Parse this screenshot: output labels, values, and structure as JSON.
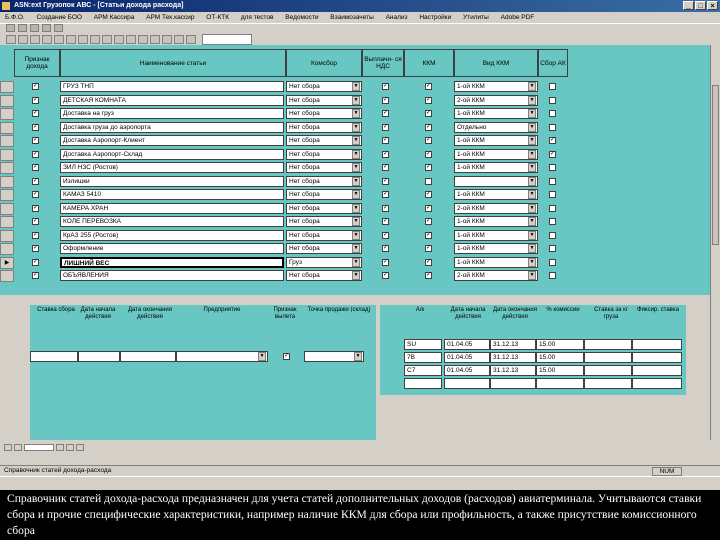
{
  "window": {
    "title": "ASN:ext Грузопок АВС - [Статьи дохода расхода]"
  },
  "menu": [
    "Б.Ф.О.",
    "Создание БОО",
    "АРМ Кассира",
    "АРМ Тех.кассир",
    "ОТ-КТК",
    "для тестов",
    "Ведомости",
    "Взаимозачеты",
    "Анализ",
    "Настройки",
    "Утилиты",
    "Adobe PDF"
  ],
  "header": {
    "col1": "Признак дохода",
    "col2": "Наименование статьи",
    "col3": "Комсбор",
    "col4": "Выплачи- ся НДС",
    "col5": "ККМ",
    "col6": "Вид ККМ",
    "col7": "Сбор АК"
  },
  "rows": [
    {
      "name": "ГРУЗ ТНП",
      "kom": "Нет сбора",
      "vid": "1-ой ККМ",
      "nds": "✓",
      "kkm": "✓",
      "ak": ""
    },
    {
      "name": "ДЕТСКАЯ КОМНАТА",
      "kom": "Нет сбора",
      "vid": "2-ой ККМ",
      "nds": "✓",
      "kkm": "✓",
      "ak": ""
    },
    {
      "name": "Доставка на груз",
      "kom": "Нет сбора",
      "vid": "1-ой ККМ",
      "nds": "✓",
      "kkm": "✓",
      "ak": ""
    },
    {
      "name": "Доставка груза до аэропорта",
      "kom": "Нет сбора",
      "vid": "Отдельно",
      "nds": "✓",
      "kkm": "✓",
      "ak": ""
    },
    {
      "name": "Доставка Аэропорт-Клиент",
      "kom": "Нет сбора",
      "vid": "1-ой ККМ",
      "nds": "✓",
      "kkm": "✓",
      "ak": "✓"
    },
    {
      "name": "Доставка Аэропорт-Склад",
      "kom": "Нет сбора",
      "vid": "1-ой ККМ",
      "nds": "✓",
      "kkm": "✓",
      "ak": "✓"
    },
    {
      "name": "ЗИЛ НЗС (Ростов)",
      "kom": "Нет сбора",
      "vid": "1-ой ККМ",
      "nds": "✓",
      "kkm": "✓",
      "ak": ""
    },
    {
      "name": "Излишки",
      "kom": "Нет сбора",
      "vid": "",
      "nds": "✓",
      "kkm": "",
      "ak": ""
    },
    {
      "name": "КАМАЗ 5410",
      "kom": "Нет сбора",
      "vid": "1-ой ККМ",
      "nds": "✓",
      "kkm": "✓",
      "ak": ""
    },
    {
      "name": "КАМЕРА ХРАН",
      "kom": "Нет сбора",
      "vid": "2-ой ККМ",
      "nds": "✓",
      "kkm": "✓",
      "ak": ""
    },
    {
      "name": "КОЛЕ ПЕРЕВОЗКА",
      "kom": "Нет сбора",
      "vid": "1-ой ККМ",
      "nds": "✓",
      "kkm": "✓",
      "ak": ""
    },
    {
      "name": "КрАЗ 255 (Ростов)",
      "kom": "Нет сбора",
      "vid": "1-ой ККМ",
      "nds": "✓",
      "kkm": "✓",
      "ak": ""
    },
    {
      "name": "Оформление",
      "kom": "Нет сбора",
      "vid": "1-ой ККМ",
      "nds": "✓",
      "kkm": "✓",
      "ak": ""
    },
    {
      "name": "ЛИШНИЙ ВЕС",
      "kom": "Груз",
      "vid": "1-ой ККМ",
      "nds": "✓",
      "kkm": "✓",
      "ak": ""
    },
    {
      "name": "ОБЪЯВЛЕНИЯ",
      "kom": "Нет сбора",
      "vid": "2-ой ККМ",
      "nds": "✓",
      "kkm": "✓",
      "ak": ""
    }
  ],
  "sub_left": {
    "headers": [
      "Ставка сбора",
      "Дата начала действия",
      "Дата окончания действия",
      "Предприятие",
      "Признак вылета",
      "Точка продажи (склад)"
    ],
    "row": {
      "a": "",
      "b": "",
      "c": "",
      "d": "",
      "e": "✓",
      "f": ""
    }
  },
  "sub_right": {
    "headers": [
      "А/к",
      "Дата начала действия",
      "Дата окончания действия",
      "% комиссии",
      "Ставка за кг груза",
      "Фиксир. ставка"
    ],
    "rows": [
      {
        "ak": "SU",
        "d1": "01.04.05",
        "d2": "31.12.13",
        "pct": "15.00"
      },
      {
        "ak": "7B",
        "d1": "01.04.05",
        "d2": "31.12.13",
        "pct": "15.00"
      },
      {
        "ak": "C7",
        "d1": "01.04.05",
        "d2": "31.12.13",
        "pct": "15.00"
      }
    ]
  },
  "status": {
    "num": "NUM",
    "left": "Справочник статей дохода-расхода"
  },
  "caption": "Справочник статей дохода-расхода предназначен для учета статей дополнительных доходов (расходов) авиатерминала. Учитываются ставки сбора и прочие специфические характеристики, например наличие ККМ для сбора или профильность, а также присутствие комиссионного сбора"
}
